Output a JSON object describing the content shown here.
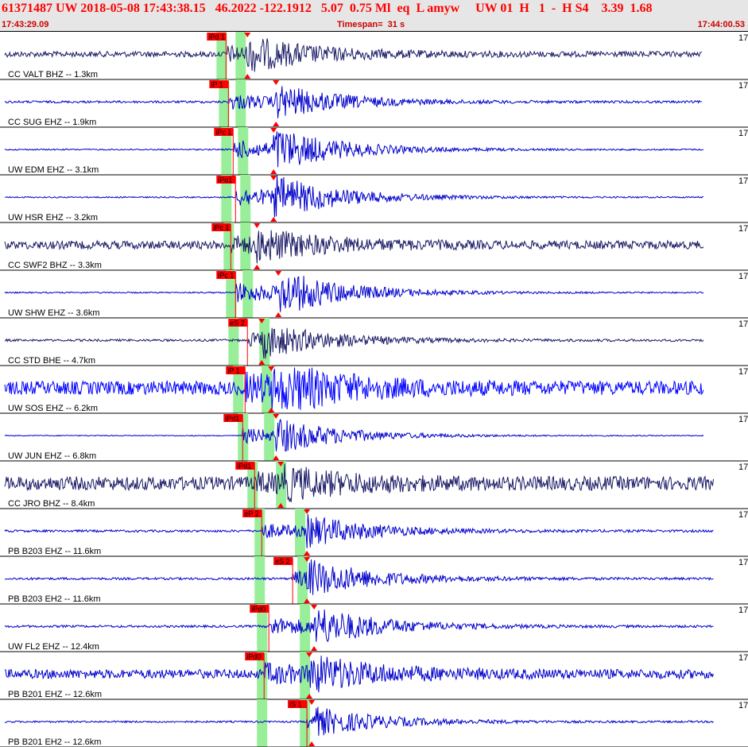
{
  "header": {
    "title": "61371487 UW 2018-05-08 17:43:38.15   46.2022 -122.1912   5.07  0.75 Ml  eq  L amyw     UW 01  H   1  -  H S4    3.39  1.68",
    "start_time": "17:43:29.09",
    "timespan": "Timespan=  31 s",
    "end_time": "17:44:00.53"
  },
  "chart_data": {
    "type": "seismogram",
    "x_unit": "s",
    "xlim": [
      0,
      31.44
    ],
    "traces": [
      {
        "label": "CC VALT BHZ -- 1.3km",
        "p_pick": "iPd 1",
        "p_time": 9.5,
        "s_time": 10.4,
        "mark_p": 9.3,
        "mark_s": 10.1,
        "color": "#1a1a66",
        "amp": 0.55,
        "noise": 0.12,
        "end": 29.5,
        "trunc": "17"
      },
      {
        "label": "CC SUG EHZ -- 1.9km",
        "p_pick": "iP 1",
        "p_time": 9.6,
        "s_time": 11.6,
        "mark_p": 9.4,
        "mark_s": 10.1,
        "color": "#0000cc",
        "amp": 0.6,
        "noise": 0.05,
        "end": 29.5,
        "trunc": "17"
      },
      {
        "label": "UW EDM EHZ -- 3.1km",
        "p_pick": "iPc 1",
        "p_time": 9.8,
        "s_time": 11.5,
        "mark_p": 9.5,
        "mark_s": 10.2,
        "color": "#0000cc",
        "amp": 0.75,
        "noise": 0.03,
        "end": 29.6,
        "trunc": "17"
      },
      {
        "label": "UW HSR EHZ -- 3.2km",
        "p_pick": "iPd1",
        "p_time": 9.9,
        "s_time": 11.5,
        "mark_p": 9.5,
        "mark_s": 10.3,
        "color": "#0000cc",
        "amp": 0.75,
        "noise": 0.03,
        "end": 29.6,
        "trunc": "17"
      },
      {
        "label": "CC SWF2 BHZ -- 3.3km",
        "p_pick": "iPc 1",
        "p_time": 9.7,
        "s_time": 10.8,
        "mark_p": 9.6,
        "mark_s": 10.3,
        "color": "#1a1a66",
        "amp": 0.5,
        "noise": 0.18,
        "end": 29.6,
        "trunc": "17"
      },
      {
        "label": "UW SHW EHZ -- 3.6km",
        "p_pick": "iPc 1",
        "p_time": 9.9,
        "s_time": 11.7,
        "mark_p": 9.7,
        "mark_s": 10.4,
        "color": "#0000cc",
        "amp": 0.8,
        "noise": 0.03,
        "end": 29.6,
        "trunc": "17"
      },
      {
        "label": "CC STD BHE -- 4.7km",
        "p_pick": "eS 2",
        "p_time": 10.4,
        "s_time": 11.0,
        "mark_p": 9.8,
        "mark_s": 11.1,
        "color": "#1a1a66",
        "amp": 0.55,
        "noise": 0.05,
        "end": 29.6,
        "trunc": "17"
      },
      {
        "label": "UW SOS EHZ -- 6.2km",
        "p_pick": "iP 1",
        "p_time": 10.3,
        "s_time": 11.4,
        "mark_p": 10.0,
        "mark_s": 11.2,
        "color": "#0000ff",
        "amp": 0.85,
        "noise": 0.3,
        "end": 29.6,
        "trunc": "17"
      },
      {
        "label": "UW JUN EHZ -- 6.8km",
        "p_pick": "iPd1",
        "p_time": 10.2,
        "s_time": 11.6,
        "mark_p": 10.2,
        "mark_s": 11.3,
        "color": "#0000cc",
        "amp": 0.6,
        "noise": 0.02,
        "end": 29.6,
        "trunc": "17"
      },
      {
        "label": "CC JRO BHZ -- 8.4km",
        "p_pick": "iPd1",
        "p_time": 10.7,
        "s_time": 11.8,
        "mark_p": 10.6,
        "mark_s": 11.8,
        "color": "#1a1a66",
        "amp": 0.45,
        "noise": 0.3,
        "end": 30.0,
        "trunc": "17"
      },
      {
        "label": "PB B203 EHZ -- 11.6km",
        "p_pick": "eP 2",
        "p_time": 11.0,
        "s_time": 12.9,
        "mark_p": 10.9,
        "mark_s": 12.6,
        "color": "#0000cc",
        "amp": 0.55,
        "noise": 0.05,
        "end": 30.0,
        "trunc": "17"
      },
      {
        "label": "PB B203 EH2 -- 11.6km",
        "p_pick": "eS 2",
        "p_time": 12.3,
        "s_time": 12.9,
        "mark_p": 10.9,
        "mark_s": 12.7,
        "color": "#0000cc",
        "amp": 0.6,
        "noise": 0.05,
        "end": 30.0,
        "trunc": "17"
      },
      {
        "label": "UW FL2 EHZ -- 12.4km",
        "p_pick": "iPd0",
        "p_time": 11.3,
        "s_time": 13.2,
        "mark_p": 11.0,
        "mark_s": 12.8,
        "color": "#0000cc",
        "amp": 0.7,
        "noise": 0.05,
        "end": 30.0,
        "trunc": "17"
      },
      {
        "label": "PB B201 EHZ -- 12.6km",
        "p_pick": "iPd0",
        "p_time": 11.1,
        "s_time": 13.0,
        "mark_p": 11.0,
        "mark_s": 12.8,
        "color": "#0000cc",
        "amp": 0.6,
        "noise": 0.2,
        "end": 30.0,
        "trunc": "17"
      },
      {
        "label": "PB B201 EH2 -- 12.6km",
        "p_pick": "iS 1",
        "p_time": 12.9,
        "s_time": 13.1,
        "mark_p": 11.0,
        "mark_s": 12.8,
        "color": "#0000cc",
        "amp": 0.45,
        "noise": 0.04,
        "end": 30.0,
        "trunc": "17"
      }
    ]
  },
  "colors": {
    "header_bg": "#e6e6e6",
    "header_text": "#ff0000",
    "pick_flag": "#ff0000",
    "arrival_band": "#99ee99",
    "separator": "#000000"
  }
}
